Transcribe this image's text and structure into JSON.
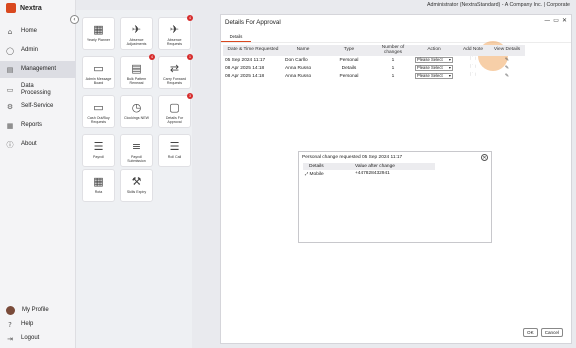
{
  "app": {
    "name": "Nextra"
  },
  "topbar": {
    "user_text": "Administrator (NextraStandard) - A Company Inc. | Corporate"
  },
  "sidebar": {
    "items": [
      {
        "label": "Home",
        "icon": "home-icon"
      },
      {
        "label": "Admin",
        "icon": "user-icon"
      },
      {
        "label": "Management",
        "icon": "management-icon",
        "active": true
      },
      {
        "label": "Data Processing",
        "icon": "data-processing-icon"
      },
      {
        "label": "Self-Service",
        "icon": "self-service-icon"
      },
      {
        "label": "Reports",
        "icon": "reports-icon"
      },
      {
        "label": "About",
        "icon": "info-icon"
      }
    ],
    "bottom": [
      {
        "label": "My Profile",
        "icon": "avatar"
      },
      {
        "label": "Help",
        "icon": "help-icon"
      },
      {
        "label": "Logout",
        "icon": "logout-icon"
      }
    ]
  },
  "tiles": [
    {
      "label": "Yearly Planner",
      "icon": "calendar-icon"
    },
    {
      "label": "Absence Adjustments",
      "icon": "absence-icon"
    },
    {
      "label": "Absence Requests",
      "icon": "plane-icon",
      "badge": "4"
    },
    {
      "label": "Admin Message Board",
      "icon": "message-board-icon"
    },
    {
      "label": "Bulk Pattern Renewal",
      "icon": "bulk-pattern-icon",
      "badge": "4"
    },
    {
      "label": "Carry Forward Requests",
      "icon": "carry-forward-icon",
      "badge": "1"
    },
    {
      "label": "Cash Out/Buy Requests",
      "icon": "cash-icon"
    },
    {
      "label": "Clockings NEW",
      "icon": "clock-icon"
    },
    {
      "label": "Details For Approval",
      "icon": "details-icon",
      "badge": "3"
    },
    {
      "label": "Payroll",
      "icon": "payroll-icon"
    },
    {
      "label": "Payroll Submission",
      "icon": "database-icon"
    },
    {
      "label": "Roll Call",
      "icon": "roll-call-icon"
    },
    {
      "label": "Rota",
      "icon": "rota-icon"
    },
    {
      "label": "Skills Expiry",
      "icon": "skills-icon"
    }
  ],
  "window": {
    "title": "Details For Approval",
    "tab": "Details",
    "columns": [
      "Date & Time Requested",
      "Name",
      "Type",
      "Number of changes",
      "Action",
      "Add Note",
      "View Details"
    ],
    "rows": [
      {
        "date": "05 Sep 2024 11:17",
        "name": "Don Carllo",
        "type": "Personal",
        "changes": "1",
        "action": "Please Select"
      },
      {
        "date": "08 Apr 2025 14:18",
        "name": "Anna Russo",
        "type": "Details",
        "changes": "1",
        "action": "Please Select"
      },
      {
        "date": "08 Apr 2025 14:18",
        "name": "Anna Russo",
        "type": "Personal",
        "changes": "1",
        "action": "Please Select"
      }
    ],
    "ok_label": "OK",
    "cancel_label": "Cancel"
  },
  "popup": {
    "title": "Personal change requested 05 Sep 2024 11:17",
    "headers": [
      "Details",
      "Value after change"
    ],
    "row": {
      "field": "Mobile",
      "value": "+447828432941"
    }
  },
  "colors": {
    "accent": "#d9481f",
    "highlight": "#f0a860",
    "badge": "#d62c2c"
  }
}
